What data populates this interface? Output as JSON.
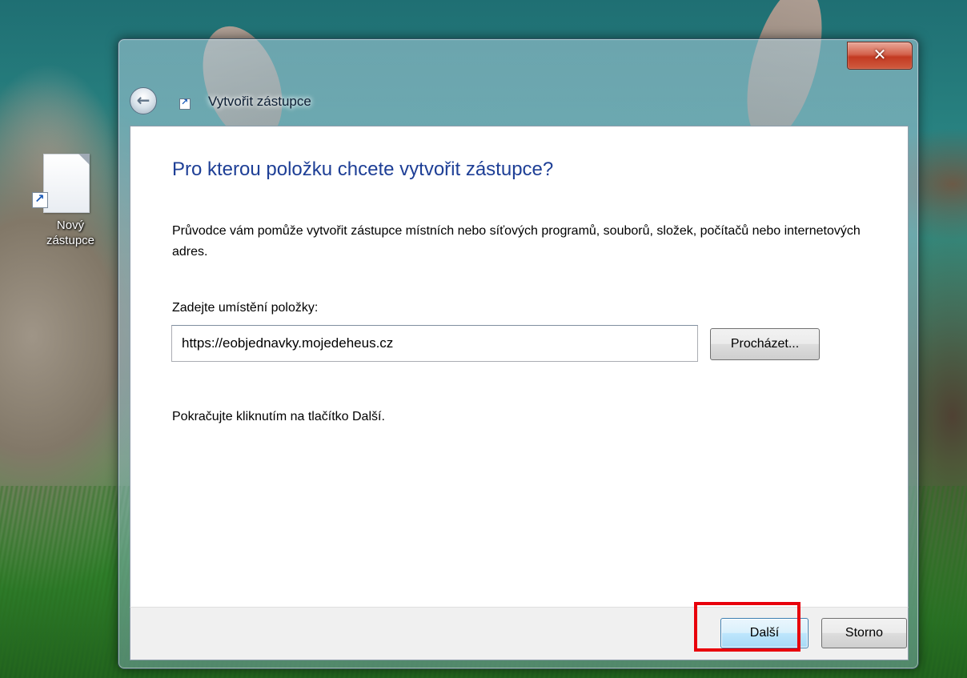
{
  "desktop": {
    "icon_label": "Nový zástupce"
  },
  "window": {
    "title": "Vytvořit zástupce",
    "close_symbol": "✕",
    "back_symbol": "←"
  },
  "wizard": {
    "heading": "Pro kterou položku chcete vytvořit zástupce?",
    "description": "Průvodce vám pomůže vytvořit zástupce místních nebo síťových programů, souborů, složek, počítačů nebo internetových adres.",
    "field_label": "Zadejte umístění položky:",
    "location_value": "https://eobjednavky.mojedeheus.cz",
    "browse_label": "Procházet...",
    "hint": "Pokračujte kliknutím na tlačítko Další."
  },
  "footer": {
    "next_label": "Další",
    "cancel_label": "Storno"
  },
  "colors": {
    "heading": "#1e3f96",
    "highlight": "#e8000b"
  }
}
